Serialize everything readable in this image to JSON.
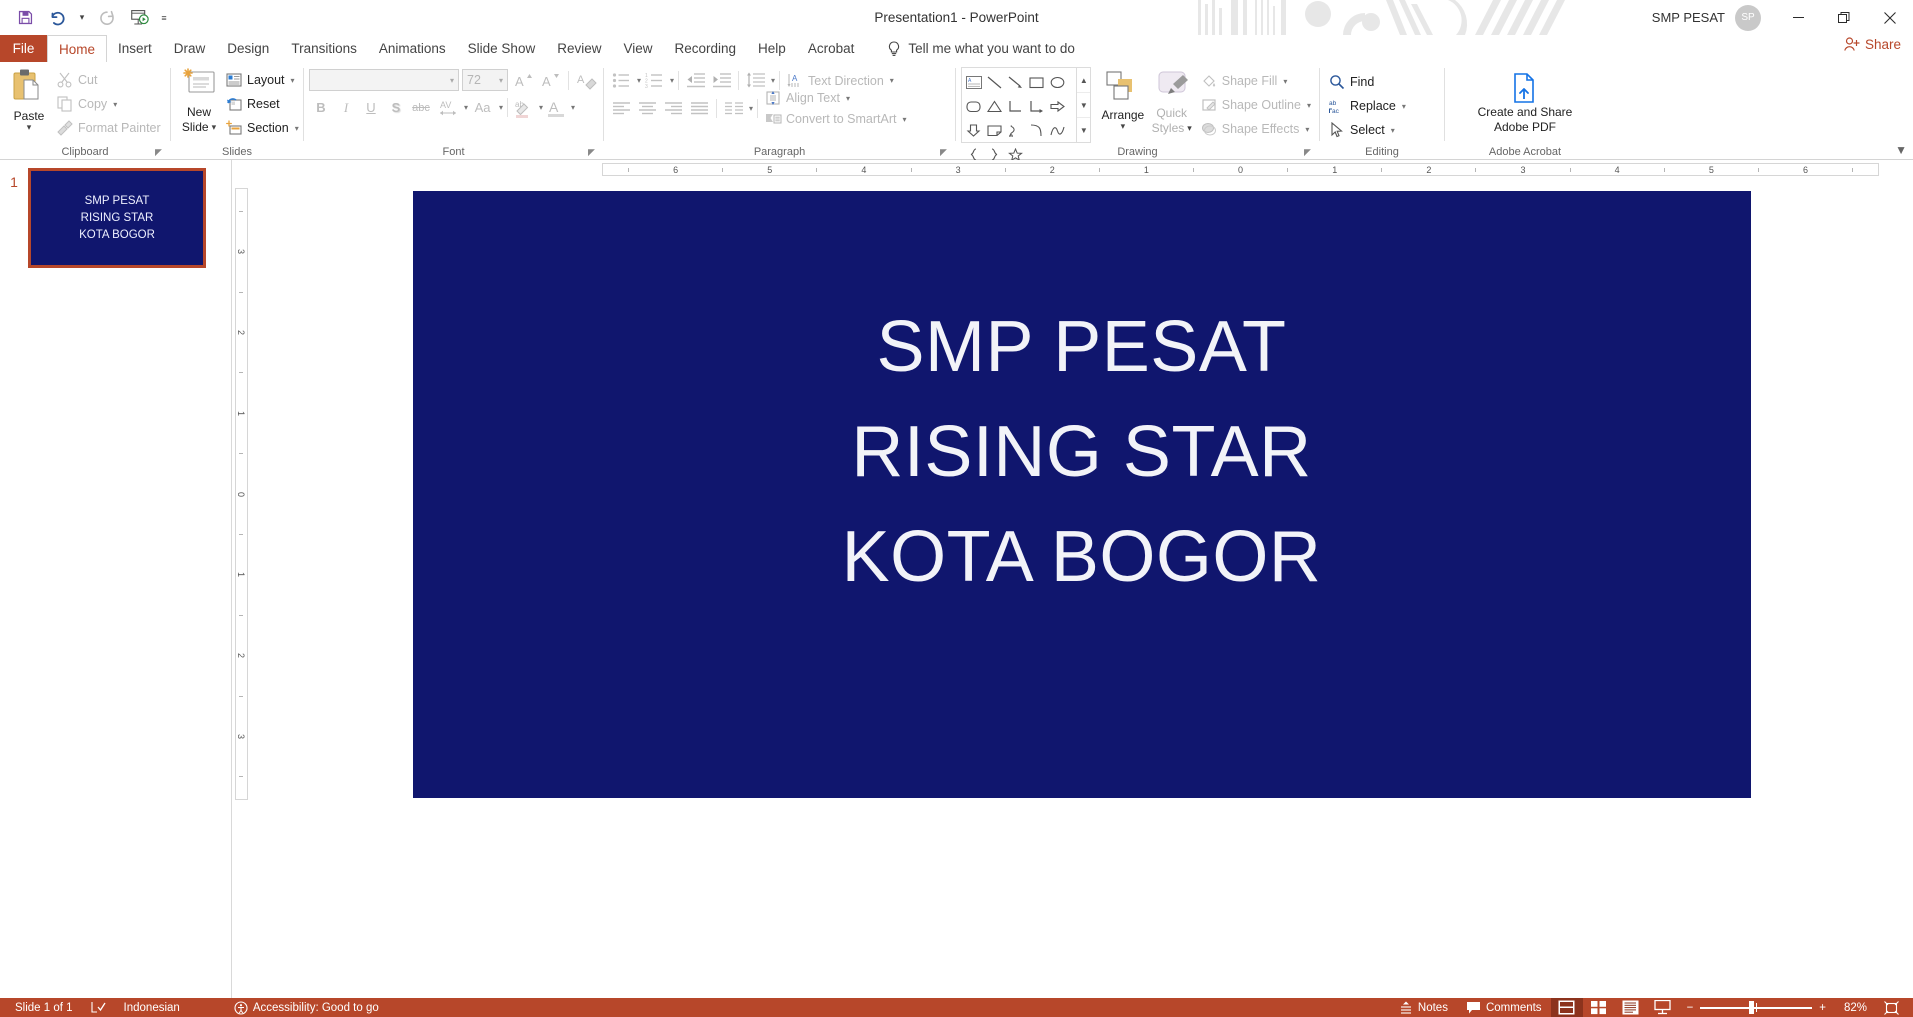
{
  "titlebar": {
    "title": "Presentation1  -  PowerPoint",
    "account_name": "SMP PESAT",
    "account_initials": "SP",
    "qat": [
      {
        "name": "save",
        "icon": "save-icon"
      },
      {
        "name": "undo",
        "icon": "undo-icon"
      },
      {
        "name": "redo",
        "icon": "redo-icon"
      },
      {
        "name": "start-from-beginning",
        "icon": "slideshow-icon"
      },
      {
        "name": "customize-qat",
        "icon": "chevron-down-icon"
      }
    ],
    "window": {
      "minimize": "─",
      "restore": "❐",
      "close": "✕"
    }
  },
  "tabs": [
    {
      "label": "File",
      "active": false
    },
    {
      "label": "Home",
      "active": true
    },
    {
      "label": "Insert",
      "active": false
    },
    {
      "label": "Draw",
      "active": false
    },
    {
      "label": "Design",
      "active": false
    },
    {
      "label": "Transitions",
      "active": false
    },
    {
      "label": "Animations",
      "active": false
    },
    {
      "label": "Slide Show",
      "active": false
    },
    {
      "label": "Review",
      "active": false
    },
    {
      "label": "View",
      "active": false
    },
    {
      "label": "Recording",
      "active": false
    },
    {
      "label": "Help",
      "active": false
    },
    {
      "label": "Acrobat",
      "active": false
    }
  ],
  "tellme": "Tell me what you want to do",
  "share": "Share",
  "ribbon": {
    "clipboard": {
      "label": "Clipboard",
      "paste": "Paste",
      "cut": "Cut",
      "copy": "Copy",
      "format_painter": "Format Painter"
    },
    "slides": {
      "label": "Slides",
      "new_slide": "New\nSlide",
      "new_slide_line1": "New",
      "new_slide_line2": "Slide",
      "layout": "Layout",
      "reset": "Reset",
      "section": "Section"
    },
    "font": {
      "label": "Font",
      "font_name_value": "",
      "font_name_placeholder": "",
      "font_size_value": "72",
      "buttons": [
        "B",
        "I",
        "U",
        "S",
        "abc",
        "AV",
        "Aa"
      ],
      "increase_font": "A",
      "decrease_font": "A",
      "clear_formatting": "A"
    },
    "paragraph": {
      "label": "Paragraph",
      "text_direction": "Text Direction",
      "align_text": "Align Text",
      "convert_smartart": "Convert to SmartArt"
    },
    "drawing": {
      "label": "Drawing",
      "arrange": "Arrange",
      "quick_styles_line1": "Quick",
      "quick_styles_line2": "Styles",
      "shape_fill": "Shape Fill",
      "shape_outline": "Shape Outline",
      "shape_effects": "Shape Effects"
    },
    "editing": {
      "label": "Editing",
      "find": "Find",
      "replace": "Replace",
      "select": "Select"
    },
    "acrobat": {
      "label": "Adobe Acrobat",
      "create_share_line1": "Create and Share",
      "create_share_line2": "Adobe PDF"
    }
  },
  "slide_panel": {
    "slide_number": "1",
    "thumb_lines": [
      "SMP PESAT",
      "RISING STAR",
      "KOTA BOGOR"
    ]
  },
  "ruler": {
    "horizontal": [
      "6",
      "5",
      "4",
      "3",
      "2",
      "1",
      "0",
      "1",
      "2",
      "3",
      "4",
      "5",
      "6"
    ],
    "vertical": [
      "3",
      "2",
      "1",
      "0",
      "1",
      "2",
      "3"
    ]
  },
  "slide": {
    "background_color": "#10166e",
    "text_color": "#f2f3f8",
    "lines": [
      "SMP PESAT",
      "RISING STAR",
      "KOTA BOGOR"
    ]
  },
  "statusbar": {
    "slide_count": "Slide 1 of 1",
    "language": "Indonesian",
    "accessibility": "Accessibility: Good to go",
    "notes": "Notes",
    "comments": "Comments",
    "zoom_level": "82%",
    "background_color": "#b7472a",
    "views": [
      "normal-view",
      "slide-sorter-view",
      "reading-view",
      "slideshow-view"
    ]
  }
}
